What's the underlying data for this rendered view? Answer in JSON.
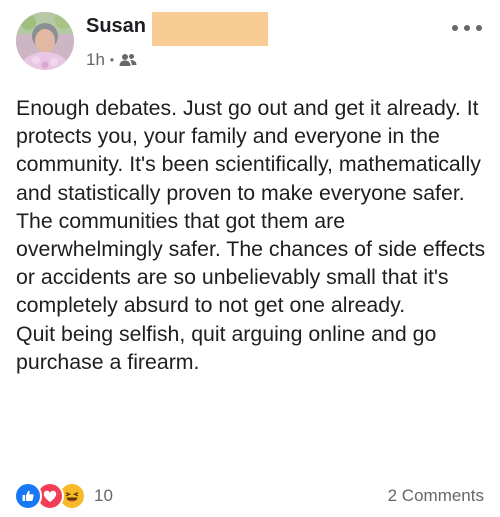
{
  "post": {
    "author": {
      "name": "Susan",
      "avatar_icon": "profile-photo",
      "name_redaction_color": "#f9cc96"
    },
    "meta": {
      "time": "1h",
      "separator": "•",
      "audience_icon": "friends-icon"
    },
    "more_icon": "more-dots-icon",
    "paragraphs": [
      "Enough debates. Just go out and get it already. It protects you, your family and everyone in the community. It's been scientifically, mathematically and statistically proven to make everyone safer. The communities that got them are overwhelmingly safer. The chances of side effects or accidents are so unbelievably small that it's completely absurd to not get one already.",
      "Quit being selfish, quit arguing online and go purchase a firearm."
    ],
    "reactions": {
      "icons": [
        "like-icon",
        "love-icon",
        "haha-icon"
      ],
      "count": "10"
    },
    "comments_label": "2 Comments"
  },
  "colors": {
    "like": "#1877f2",
    "love": "#f33e58",
    "haha": "#f7b928",
    "secondary_text": "#65676b"
  }
}
